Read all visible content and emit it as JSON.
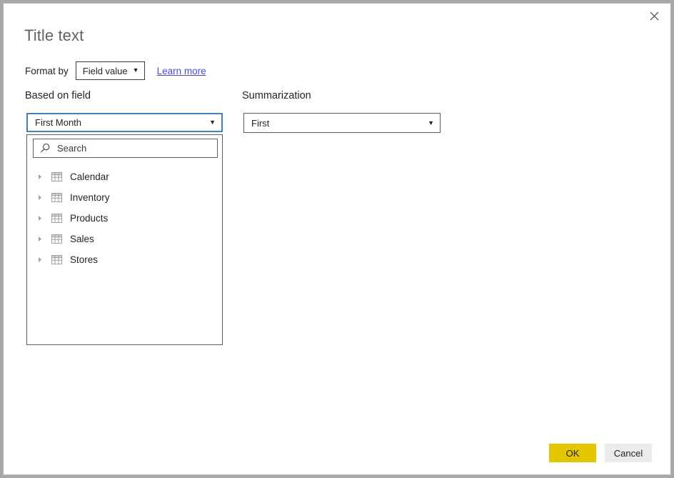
{
  "dialog": {
    "title": "Title text",
    "close_icon": "close-icon"
  },
  "format_by": {
    "label": "Format by",
    "selected": "Field value",
    "caret": "▼",
    "learn_more": "Learn more",
    "link_color": "#4a4ad1"
  },
  "based_on_field": {
    "label": "Based on field",
    "selected": "First Month",
    "caret": "▼",
    "focus_border_color": "#4a7ebb",
    "search": {
      "icon": "search-icon",
      "placeholder": "Search",
      "value": ""
    },
    "tree": [
      {
        "label": "Calendar",
        "expand_icon": "chevron-right-icon",
        "type_icon": "table-icon",
        "expanded": false
      },
      {
        "label": "Inventory",
        "expand_icon": "chevron-right-icon",
        "type_icon": "table-icon",
        "expanded": false
      },
      {
        "label": "Products",
        "expand_icon": "chevron-right-icon",
        "type_icon": "table-icon",
        "expanded": false
      },
      {
        "label": "Sales",
        "expand_icon": "chevron-right-icon",
        "type_icon": "table-icon",
        "expanded": false
      },
      {
        "label": "Stores",
        "expand_icon": "chevron-right-icon",
        "type_icon": "table-icon",
        "expanded": false
      }
    ]
  },
  "summarization": {
    "label": "Summarization",
    "selected": "First",
    "caret": "▼"
  },
  "footer": {
    "ok_label": "OK",
    "cancel_label": "Cancel",
    "ok_color": "#e3c700",
    "cancel_color": "#ebebeb"
  }
}
